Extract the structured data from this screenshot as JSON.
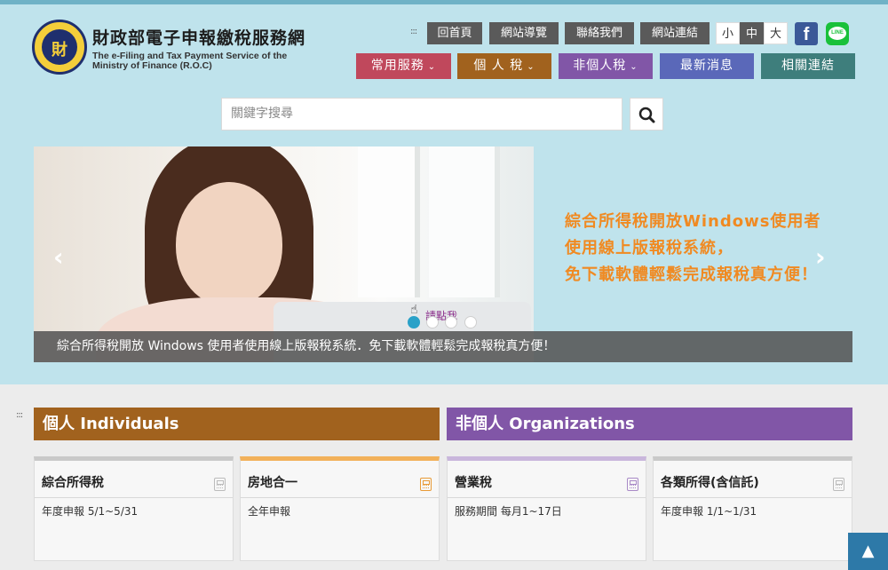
{
  "header": {
    "title": "財政部電子申報繳稅服務網",
    "subtitle_line1": "The e-Filing and Tax Payment Service of the",
    "subtitle_line2": "Ministry of Finance (R.O.C)",
    "logo_glyph": "財"
  },
  "accessibility_marker": ":::",
  "top_links": [
    "回首頁",
    "網站導覽",
    "聯絡我們",
    "網站連結"
  ],
  "font_size": {
    "small": "小",
    "medium": "中",
    "large": "大",
    "selected": "中"
  },
  "social": {
    "facebook": "f",
    "line": "LINE"
  },
  "nav": [
    {
      "label": "常用服務",
      "color": "#c0485c",
      "caret": "⌄"
    },
    {
      "label": "個 人 稅",
      "color": "#a1621e",
      "caret": "⌄"
    },
    {
      "label": "非個人稅",
      "color": "#8156a7",
      "caret": "⌄"
    },
    {
      "label": "最新消息",
      "color": "#5a68b9",
      "caret": ""
    },
    {
      "label": "相關連結",
      "color": "#3e7e7c",
      "caret": ""
    }
  ],
  "search": {
    "placeholder": "關鍵字搜尋",
    "icon": "search-icon"
  },
  "carousel": {
    "promo_line1": "綜合所得稅開放Windows使用者",
    "promo_line2": "使用線上版報稅系統，",
    "promo_line3": "免下載軟體輕鬆完成報稅真方便！",
    "caption": "綜合所得稅開放 Windows 使用者使用線上版報稅系統．免下載軟體輕鬆完成報稅真方便！",
    "click_hint": "請點我",
    "slide_count": 4,
    "active_slide": 1,
    "prev_icon": "‹",
    "next_icon": "›"
  },
  "sections": {
    "individuals": {
      "label": "個人 Individuals",
      "color": "#a1621e"
    },
    "organizations": {
      "label": "非個人 Organizations",
      "color": "#8156a7"
    }
  },
  "cards": [
    {
      "title": "綜合所得稅",
      "text": "年度申報 5/1~5/31",
      "accent": "#c9c9c9",
      "icon_color": "#bbbbbb"
    },
    {
      "title": "房地合一",
      "text": "全年申報",
      "accent": "#f2b15a",
      "icon_color": "#e89a36"
    },
    {
      "title": "營業稅",
      "text": "服務期間 每月1~17日",
      "accent": "#c9b6dc",
      "icon_color": "#a98ac7"
    },
    {
      "title": "各類所得(含信託)",
      "text": "年度申報 1/1~1/31",
      "accent": "#c9c9c9",
      "icon_color": "#bbbbbb"
    }
  ],
  "scroll_top_icon": "▲"
}
